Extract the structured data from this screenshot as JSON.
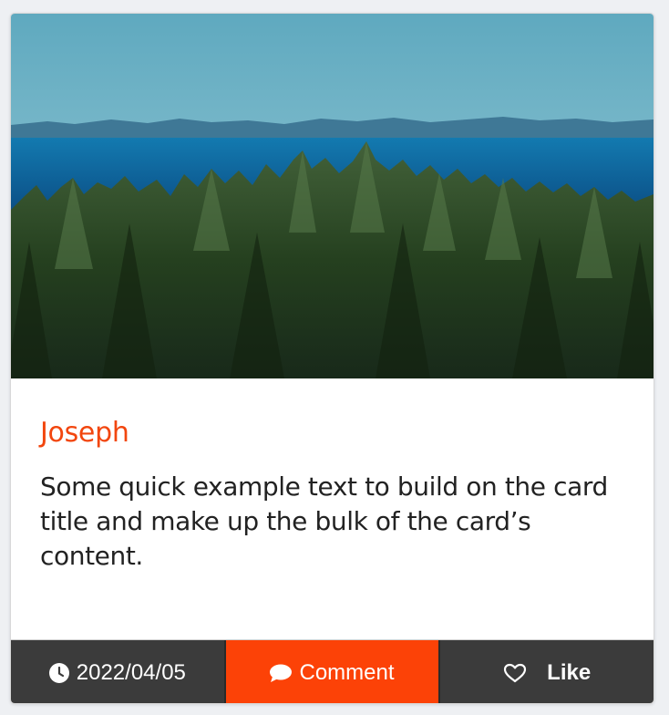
{
  "card": {
    "title": "Joseph",
    "text": "Some quick example text to build on the card title and make up the bulk of the card’s content.",
    "image_icon": "forest-lake-photo"
  },
  "footer": {
    "date": "2022/04/05",
    "date_icon": "clock-icon",
    "comment_label": "Comment",
    "comment_icon": "speech-bubble-icon",
    "like_label": "Like",
    "like_icon": "heart-outline-icon"
  },
  "colors": {
    "accent": "#fc4207",
    "title": "#f2460e",
    "footer_dark": "#3b3b3b",
    "text": "#222222"
  }
}
